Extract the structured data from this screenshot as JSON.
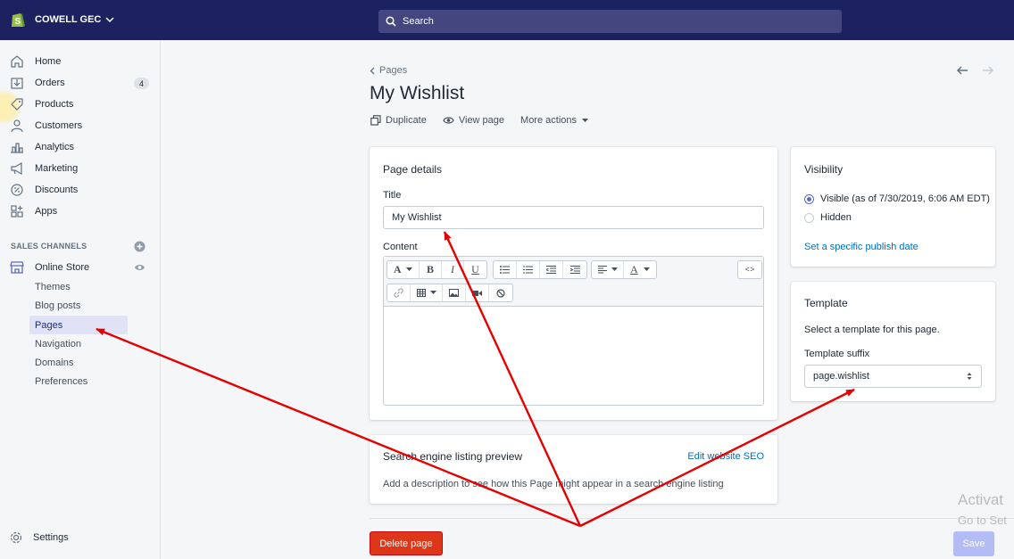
{
  "topbar": {
    "store_name": "COWELL GEC",
    "search_placeholder": "Search"
  },
  "sidebar": {
    "items": [
      {
        "label": "Home",
        "icon": "home-icon"
      },
      {
        "label": "Orders",
        "icon": "orders-icon",
        "badge": "4"
      },
      {
        "label": "Products",
        "icon": "tag-icon"
      },
      {
        "label": "Customers",
        "icon": "person-icon"
      },
      {
        "label": "Analytics",
        "icon": "bar-chart-icon"
      },
      {
        "label": "Marketing",
        "icon": "megaphone-icon"
      },
      {
        "label": "Discounts",
        "icon": "discount-icon"
      },
      {
        "label": "Apps",
        "icon": "apps-icon"
      }
    ],
    "sales_channels_title": "SALES CHANNELS",
    "online_store": "Online Store",
    "sub_items": [
      "Themes",
      "Blog posts",
      "Pages",
      "Navigation",
      "Domains",
      "Preferences"
    ],
    "active_sub_item": "Pages",
    "settings": "Settings"
  },
  "main": {
    "breadcrumb": "Pages",
    "title": "My Wishlist",
    "actions": {
      "duplicate": "Duplicate",
      "view_page": "View page",
      "more_actions": "More actions"
    },
    "page_details": {
      "heading": "Page details",
      "title_label": "Title",
      "title_value": "My Wishlist",
      "content_label": "Content"
    },
    "seo": {
      "heading": "Search engine listing preview",
      "edit_link": "Edit website SEO",
      "description": "Add a description to see how this Page might appear in a search engine listing"
    },
    "visibility": {
      "heading": "Visibility",
      "visible_option": "Visible (as of 7/30/2019, 6:06 AM EDT)",
      "hidden_option": "Hidden",
      "selected": "visible",
      "publish_link": "Set a specific publish date"
    },
    "template": {
      "heading": "Template",
      "description": "Select a template for this page.",
      "suffix_label": "Template suffix",
      "suffix_value": "page.wishlist"
    },
    "delete_button": "Delete page",
    "save_button": "Save"
  },
  "watermark": {
    "line1": "Activat",
    "line2": "Go to Set"
  },
  "colors": {
    "topbar": "#1c2260",
    "accent": "#5c6ac4",
    "link": "#006fbb",
    "danger": "#de3618",
    "annotation_arrow": "#e60000"
  }
}
